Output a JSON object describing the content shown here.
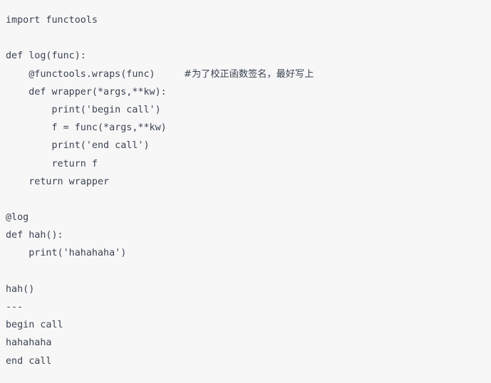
{
  "editor": {
    "background_color": "#f7f7f7",
    "text_color": "#3b4351",
    "language": "python"
  },
  "code": {
    "lines": [
      {
        "text": "import functools",
        "blank": false
      },
      {
        "text": "",
        "blank": true
      },
      {
        "text": "def log(func):",
        "blank": false
      },
      {
        "text": "    @functools.wraps(func)     ",
        "blank": false,
        "comment": "#为了校正函数签名，最好写上"
      },
      {
        "text": "    def wrapper(*args,**kw):",
        "blank": false
      },
      {
        "text": "        print('begin call')",
        "blank": false
      },
      {
        "text": "        f = func(*args,**kw)",
        "blank": false
      },
      {
        "text": "        print('end call')",
        "blank": false
      },
      {
        "text": "        return f",
        "blank": false
      },
      {
        "text": "    return wrapper",
        "blank": false
      },
      {
        "text": "",
        "blank": true
      },
      {
        "text": "@log",
        "blank": false
      },
      {
        "text": "def hah():",
        "blank": false
      },
      {
        "text": "    print('hahahaha')",
        "blank": false
      },
      {
        "text": "",
        "blank": true
      },
      {
        "text": "hah()",
        "blank": false
      },
      {
        "text": "---",
        "blank": false
      },
      {
        "text": "begin call",
        "blank": false
      },
      {
        "text": "hahahaha",
        "blank": false
      },
      {
        "text": "end call",
        "blank": false
      }
    ]
  }
}
